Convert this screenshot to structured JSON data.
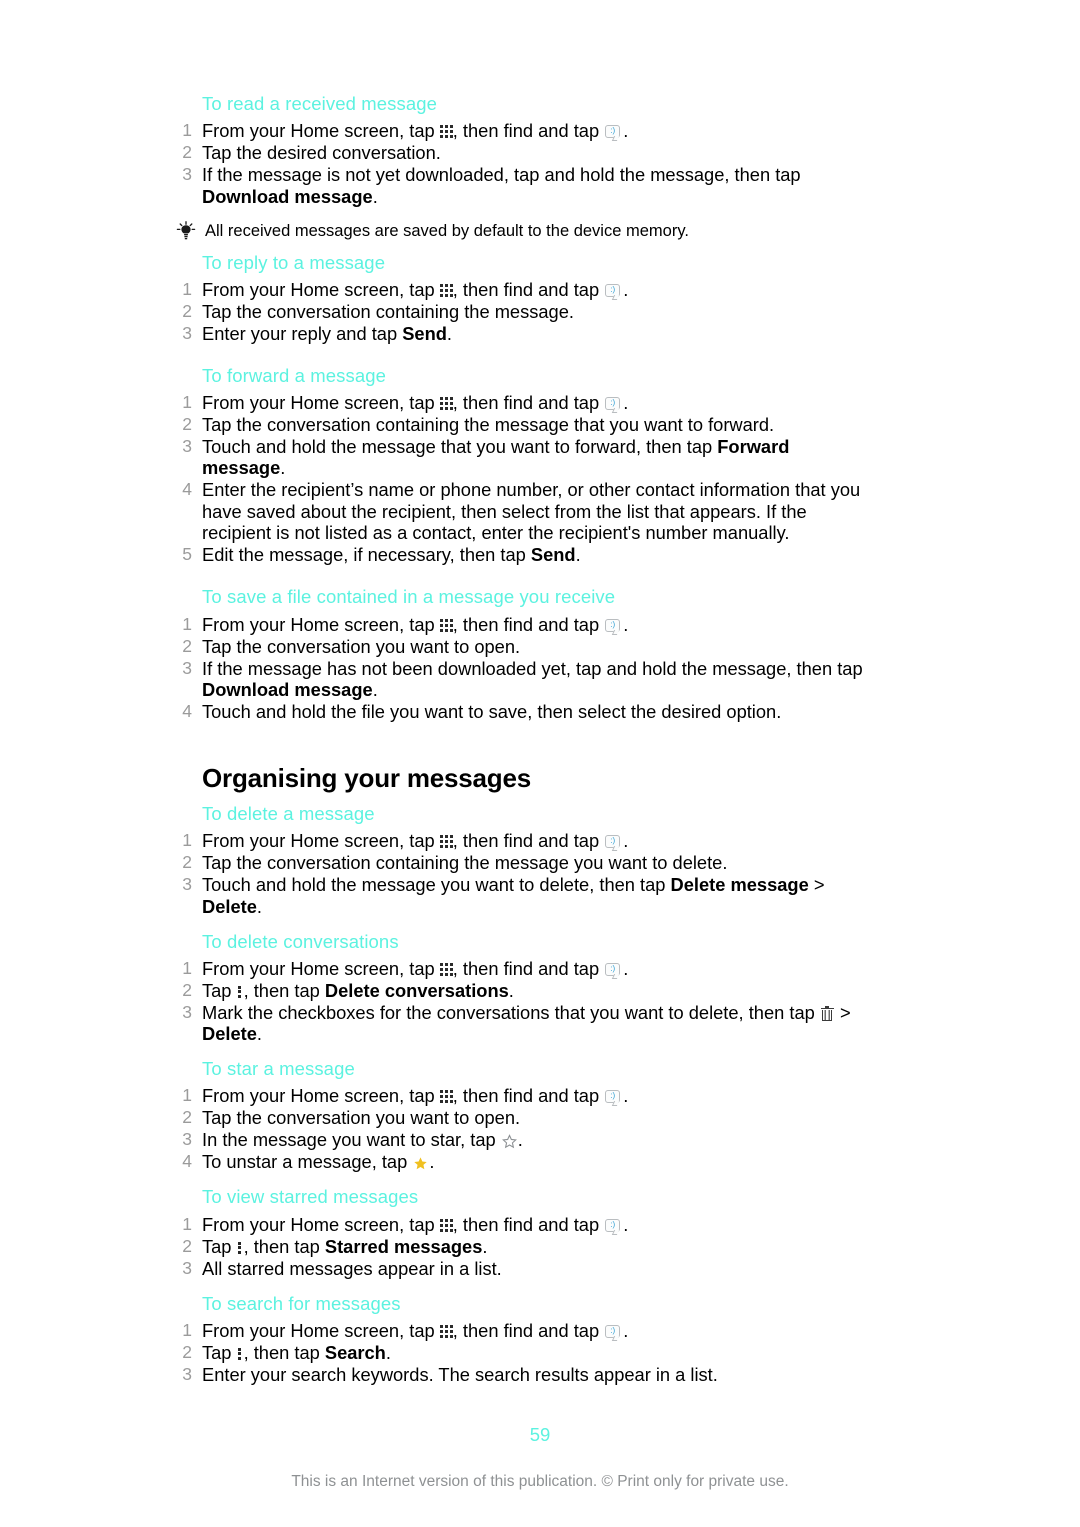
{
  "document": {
    "page_number": "59",
    "footer_legal": "This is an Internet version of this publication. © Print only for private use.",
    "accent_color": "#5cf2e0",
    "step_number_color": "#9b9b9b",
    "star_filled_color": "#f0c020",
    "footer_color": "#8e9193"
  },
  "icons": {
    "app_grid": "app-grid-icon",
    "messaging": "messaging-app-icon",
    "overflow_menu": "overflow-menu-icon",
    "trash": "trash-icon",
    "star_outline": "star-outline-icon",
    "star_filled": "star-filled-icon",
    "tip_bulb": "lightbulb-tip-icon"
  },
  "sections": [
    {
      "id": "to-read-a-received-message",
      "heading": "To read a received message",
      "steps": [
        {
          "pre": "From your Home screen, tap ",
          "icon1": "app-grid",
          "mid": ", then find and tap ",
          "icon2": "messaging",
          "post": "."
        },
        {
          "text": "Tap the desired conversation."
        },
        {
          "pre": "If the message is not yet downloaded, tap and hold the message, then tap ",
          "bold": "Download message",
          "post": "."
        }
      ],
      "tip": "All received messages are saved by default to the device memory."
    },
    {
      "id": "to-reply-to-a-message",
      "heading": "To reply to a message",
      "steps": [
        {
          "pre": "From your Home screen, tap ",
          "icon1": "app-grid",
          "mid": ", then find and tap ",
          "icon2": "messaging",
          "post": "."
        },
        {
          "text": "Tap the conversation containing the message."
        },
        {
          "pre": "Enter your reply and tap ",
          "bold": "Send",
          "post": "."
        }
      ]
    },
    {
      "id": "to-forward-a-message",
      "heading": "To forward a message",
      "steps": [
        {
          "pre": "From your Home screen, tap ",
          "icon1": "app-grid",
          "mid": ", then find and tap ",
          "icon2": "messaging",
          "post": "."
        },
        {
          "text": "Tap the conversation containing the message that you want to forward."
        },
        {
          "pre": "Touch and hold the message that you want to forward, then tap ",
          "bold": "Forward message",
          "post": "."
        },
        {
          "text": "Enter the recipient’s name or phone number, or other contact information that you have saved about the recipient, then select from the list that appears. If the recipient is not listed as a contact, enter the recipient's number manually."
        },
        {
          "pre": "Edit the message, if necessary, then tap ",
          "bold": "Send",
          "post": "."
        }
      ]
    },
    {
      "id": "to-save-a-file-contained-in-a-message-you-receive",
      "heading": "To save a file contained in a message you receive",
      "steps": [
        {
          "pre": "From your Home screen, tap ",
          "icon1": "app-grid",
          "mid": ", then find and tap ",
          "icon2": "messaging",
          "post": "."
        },
        {
          "text": "Tap the conversation you want to open."
        },
        {
          "pre": "If the message has not been downloaded yet, tap and hold the message, then tap ",
          "bold": "Download message",
          "post": "."
        },
        {
          "text": "Touch and hold the file you want to save, then select the desired option."
        }
      ]
    }
  ],
  "chapter": {
    "title": "Organising your messages",
    "sections": [
      {
        "id": "to-delete-a-message",
        "heading": "To delete a message",
        "steps": [
          {
            "pre": "From your Home screen, tap ",
            "icon1": "app-grid",
            "mid": ", then find and tap ",
            "icon2": "messaging",
            "post": "."
          },
          {
            "text": "Tap the conversation containing the message you want to delete."
          },
          {
            "pre": "Touch and hold the message you want to delete, then tap ",
            "bold": "Delete message",
            "mid2": " > ",
            "bold2": "Delete",
            "post": "."
          }
        ]
      },
      {
        "id": "to-delete-conversations",
        "heading": "To delete conversations",
        "steps": [
          {
            "pre": "From your Home screen, tap ",
            "icon1": "app-grid",
            "mid": ", then find and tap ",
            "icon2": "messaging",
            "post": "."
          },
          {
            "pre": "Tap ",
            "icon1": "overflow-menu",
            "mid": ", then tap ",
            "bold": "Delete conversations",
            "post": "."
          },
          {
            "pre": "Mark the checkboxes for the conversations that you want to delete, then tap ",
            "icon1": "trash",
            "mid": " > ",
            "bold": "Delete",
            "post": "."
          }
        ]
      },
      {
        "id": "to-star-a-message",
        "heading": "To star a message",
        "steps": [
          {
            "pre": "From your Home screen, tap ",
            "icon1": "app-grid",
            "mid": ", then find and tap ",
            "icon2": "messaging",
            "post": "."
          },
          {
            "text": "Tap the conversation you want to open."
          },
          {
            "pre": "In the message you want to star, tap ",
            "icon1": "star-outline",
            "post": "."
          },
          {
            "pre": "To unstar a message, tap ",
            "icon1": "star-filled",
            "post": "."
          }
        ]
      },
      {
        "id": "to-view-starred-messages",
        "heading": "To view starred messages",
        "steps": [
          {
            "pre": "From your Home screen, tap ",
            "icon1": "app-grid",
            "mid": ", then find and tap ",
            "icon2": "messaging",
            "post": "."
          },
          {
            "pre": "Tap ",
            "icon1": "overflow-menu",
            "mid": ", then tap ",
            "bold": "Starred messages",
            "post": "."
          },
          {
            "text": "All starred messages appear in a list."
          }
        ]
      },
      {
        "id": "to-search-for-messages",
        "heading": "To search for messages",
        "steps": [
          {
            "pre": "From your Home screen, tap ",
            "icon1": "app-grid",
            "mid": ", then find and tap ",
            "icon2": "messaging",
            "post": "."
          },
          {
            "pre": "Tap ",
            "icon1": "overflow-menu",
            "mid": ", then tap ",
            "bold": "Search",
            "post": "."
          },
          {
            "text": "Enter your search keywords. The search results appear in a list."
          }
        ]
      }
    ]
  }
}
